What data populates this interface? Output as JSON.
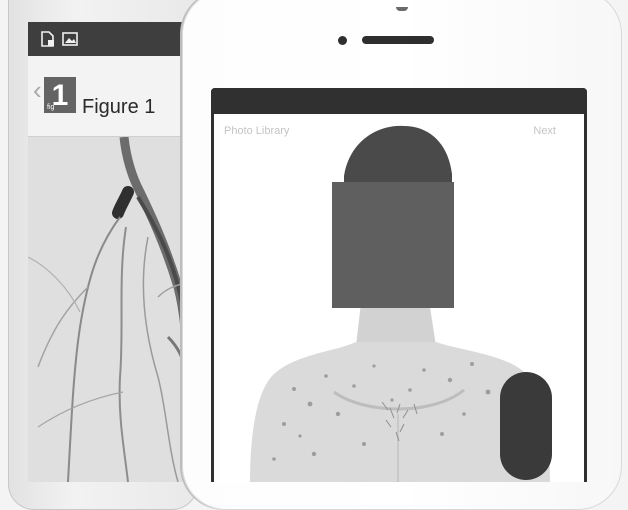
{
  "left_app": {
    "back_glyph": "‹",
    "figure_number": "1",
    "figure_number_small": "fig",
    "figure_title": "Figure 1",
    "status_icons": [
      "document-icon",
      "image-icon"
    ]
  },
  "right_app": {
    "nav_left_label": "Photo Library",
    "nav_right_label": "Next",
    "redactions": [
      "face-redaction",
      "arm-redaction"
    ]
  },
  "colors": {
    "statusbar": "#3e3e3e",
    "figure_badge": "#636363",
    "redaction_box": "#5f5f5f",
    "redaction_patch": "#3a3a3a"
  }
}
